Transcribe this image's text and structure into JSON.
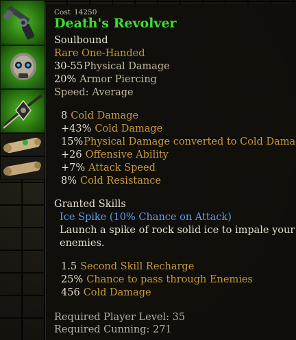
{
  "tooltip": {
    "cost_label": "Cost",
    "cost_value": "14250",
    "item_name": "Death's Revolver",
    "binding": "Soulbound",
    "rarity": "Rare One-Handed",
    "base_stats": [
      {
        "value": "30-55",
        "label": "Physical Damage"
      },
      {
        "value": "20%",
        "label": "Armor Piercing"
      },
      {
        "value": "Speed:",
        "label": "Average"
      }
    ],
    "bonus_stats": [
      {
        "value": "8",
        "label": "Cold Damage"
      },
      {
        "value": "+43%",
        "label": "Cold Damage"
      },
      {
        "value": "15%",
        "label": "Physical Damage converted to Cold Damage"
      },
      {
        "value": "+26",
        "label": "Offensive Ability"
      },
      {
        "value": "+7%",
        "label": "Attack Speed"
      },
      {
        "value": "8%",
        "label": "Cold Resistance"
      }
    ],
    "granted_skills_header": "Granted Skills",
    "skill_name": "Ice Spike (10% Chance on Attack)",
    "skill_desc_line1": "Launch a spike of rock solid ice to impale your",
    "skill_desc_line2": "enemies.",
    "skill_stats": [
      {
        "value": "1.5",
        "label": "Second Skill Recharge"
      },
      {
        "value": "25%",
        "label": "Chance to pass through Enemies"
      },
      {
        "value": "456",
        "label": "Cold Damage"
      }
    ],
    "requirements": [
      "Required Player Level: 35",
      "Required Cunning: 271"
    ]
  },
  "colors": {
    "item_name": "#3ddf32",
    "rarity": "#c99a3e",
    "stat_label": "#c3b7a2",
    "skill_name": "#5f9cf0",
    "slot_highlight": "#4fb82a"
  },
  "icons": {
    "slot1": "revolver-icon",
    "slot2": "skull-relic-icon",
    "slot3": "amulet-icon",
    "slot4": "scroll-icon",
    "slot5": "scroll-icon"
  }
}
